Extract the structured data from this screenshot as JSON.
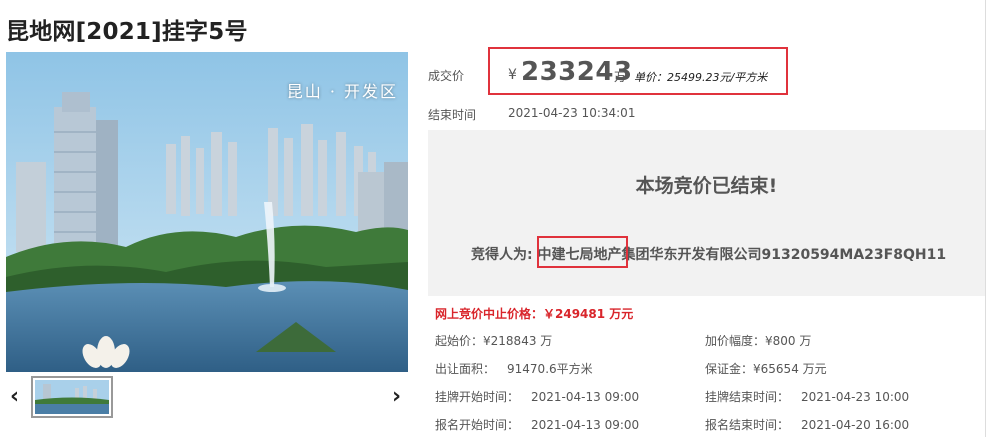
{
  "title": "昆地网[2021]挂字5号",
  "photo": {
    "caption": "昆山 · 开发区"
  },
  "price": {
    "label": "成交价",
    "currency": "¥",
    "value": "233243",
    "unit": "万",
    "unit_price": "单价：25499.23元/平方米"
  },
  "end_time": {
    "label": "结束时间",
    "value": "2021-04-23 10:34:01"
  },
  "result": {
    "title": "本场竞价已结束!",
    "winner_label": "竞得人为:",
    "winner_value": "中建七局地产集团华东开发有限公司91320594MA23F8QH11"
  },
  "limit_price": "网上竞价中止价格：￥249481 万元",
  "details": {
    "start_price": {
      "label": "起始价：",
      "value": "¥218843 万"
    },
    "increment": {
      "label": "加价幅度：",
      "value": "¥800 万"
    },
    "area": {
      "label": "出让面积：",
      "value": "91470.6平方米"
    },
    "deposit": {
      "label": "保证金：",
      "value": "¥65654 万元"
    },
    "listing_start": {
      "label": "挂牌开始时间：",
      "value": "2021-04-13 09:00"
    },
    "listing_end": {
      "label": "挂牌结束时间：",
      "value": "2021-04-23 10:00"
    },
    "signup_start": {
      "label": "报名开始时间：",
      "value": "2021-04-13 09:00"
    },
    "signup_end": {
      "label": "报名结束时间：",
      "value": "2021-04-20 16:00"
    }
  },
  "nav": {
    "prev": "‹",
    "next": "›"
  },
  "colors": {
    "accent_red": "#e0323c",
    "panel_bg": "#f2f2f2"
  },
  "icons": {
    "prev": "chevron-left-icon",
    "next": "chevron-right-icon"
  }
}
